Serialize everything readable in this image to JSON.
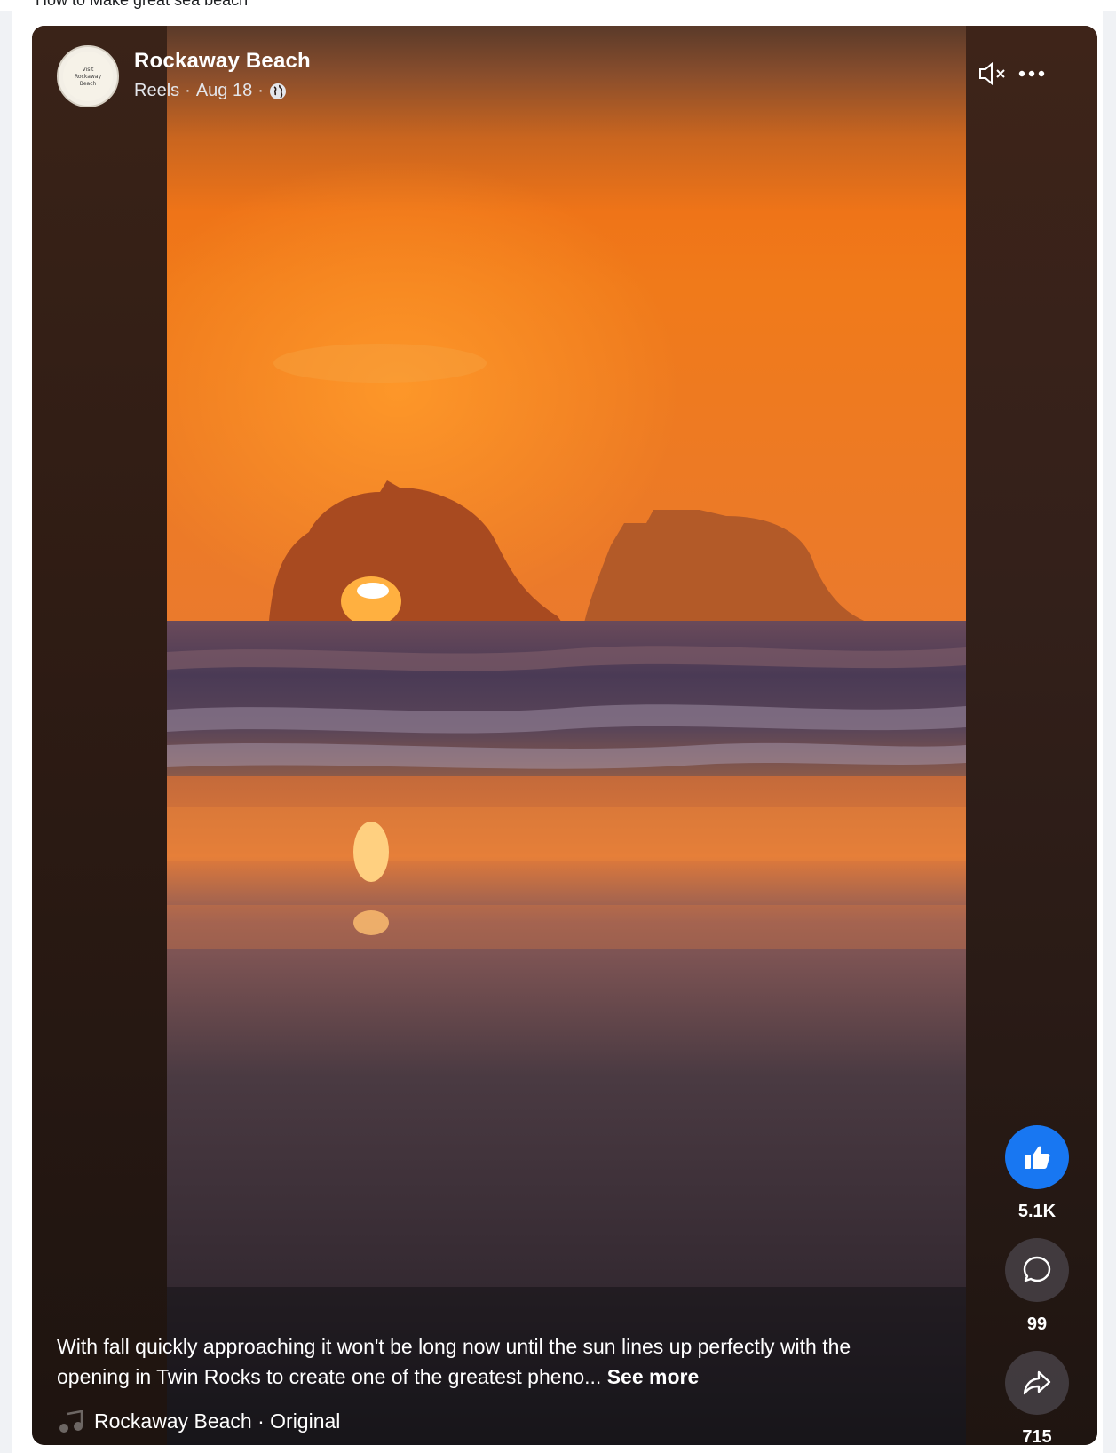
{
  "page_header": {
    "partial_text": "How to Make great sea beach"
  },
  "post": {
    "page_name": "Rockaway Beach",
    "source": "Reels",
    "separator": "·",
    "date": "Aug 18",
    "avatar_text": "Visit Rockaway Beach"
  },
  "controls": {
    "mute_icon": "muted-speaker-icon",
    "more_icon": "more-options-icon"
  },
  "actions": {
    "likes": "5.1K",
    "comments": "99",
    "shares": "715"
  },
  "caption": {
    "text": "With fall quickly approaching it won't be long now until the sun lines up perfectly with the opening in Twin Rocks to create one of the greatest pheno...",
    "see_more": "See more"
  },
  "audio": {
    "label": "Rockaway Beach · Original"
  },
  "colors": {
    "like_blue": "#1877f2",
    "sky_orange": "#f07a1a",
    "frame_dark": "#2a1a14"
  }
}
